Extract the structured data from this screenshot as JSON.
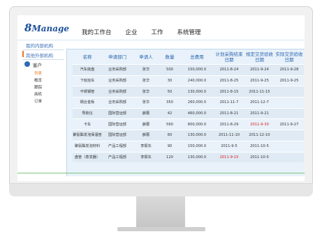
{
  "app": {
    "logo_number": "8",
    "logo_text": "Manage"
  },
  "nav": {
    "items": [
      "我的工作台",
      "企业",
      "工作",
      "系统管理"
    ]
  },
  "sidebar": {
    "links": [
      "我的内部机构",
      "其他外部机构"
    ],
    "user_label": "客户",
    "sub_items": [
      "列表",
      "概览",
      "跟踪",
      "商机",
      "订单"
    ]
  },
  "table": {
    "headers": [
      "名称",
      "申请部门",
      "申请人",
      "数量",
      "总费用",
      "计划采购结束日期",
      "规定交货验收日期",
      "实际交货验收日期"
    ],
    "rows": [
      [
        "汽车底盘",
        "业务采购部",
        "张华",
        "500",
        "150,000.0",
        "2011-8-24",
        "2011-9-24",
        "2011-9-28"
      ],
      [
        "下班班车",
        "业务采购部",
        "张华",
        "30",
        "240,000.0",
        "2011-8-25",
        "2011-9-25",
        "2011-9-25"
      ],
      [
        "不锈钢管",
        "业务采购部",
        "张华",
        "50",
        "130,000.0",
        "2011-8-15",
        "2011-11-15",
        ""
      ],
      [
        "钢合金板",
        "业务采购部",
        "张华",
        "350",
        "260,000.0",
        "2011-11-7",
        "2011-12-7",
        ""
      ],
      [
        "导航仪",
        "国际营运部",
        "薛蕾",
        "42",
        "460,000.0",
        "2011-8-21",
        "2011-9-21",
        ""
      ],
      [
        "卡车",
        "国际营运部",
        "薛蕾",
        "560",
        "800,000.0",
        "2011-8-29",
        "2011-9-30",
        "2011-9-27"
      ],
      [
        "聚氨酯发泡保温管",
        "国际营运部",
        "薛蕾",
        "60",
        "130,000.0",
        "2011-11-10",
        "2011-12-10",
        ""
      ],
      [
        "聚氨酯发泡材料",
        "产品工程部",
        "李振东",
        "90",
        "150,000.0",
        "2011-9-5",
        "2011-10-5",
        ""
      ],
      [
        "盘管（蒸发器）",
        "产品工程部",
        "李振东",
        "120",
        "130,000.0",
        "2011-9-15",
        "2011-10-5",
        ""
      ]
    ],
    "red_cells": {
      "row5_col6": "2011-9-30",
      "row8_col5": "2011-9-15"
    }
  },
  "colors": {
    "accent": "#2a64b0",
    "highlight": "#e87722",
    "alert": "#d62020",
    "panel": "#e9f2fa"
  }
}
